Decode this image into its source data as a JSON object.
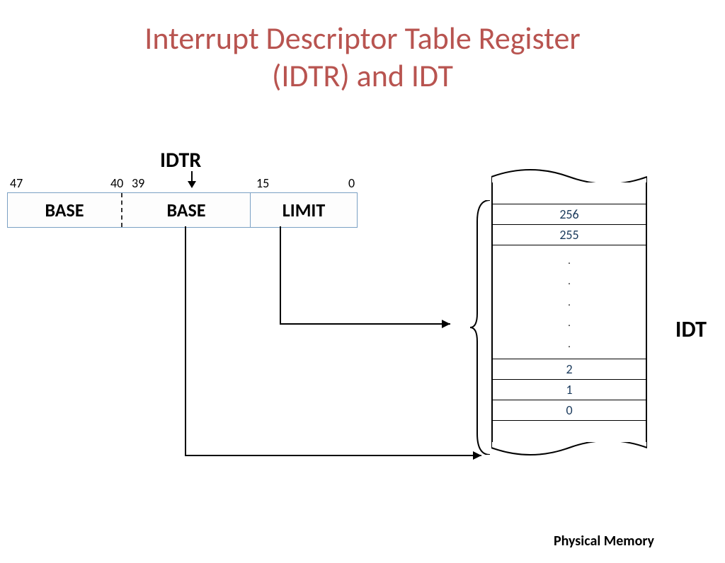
{
  "title_line1": "Interrupt Descriptor Table Register",
  "title_line2": "(IDTR) and IDT",
  "idtr_label": "IDTR",
  "bits": {
    "b47": "47",
    "b40": "40",
    "b39": "39",
    "b15": "15",
    "b0": "0"
  },
  "register": {
    "base1": "BASE",
    "base2": "BASE",
    "limit": "LIMIT"
  },
  "idt": {
    "label": "IDT",
    "rows_top": [
      "256",
      "255"
    ],
    "rows_bot": [
      "2",
      "1",
      "0"
    ],
    "dots": [
      ".",
      ".",
      ".",
      ".",
      "."
    ]
  },
  "phys_mem": "Physical Memory"
}
